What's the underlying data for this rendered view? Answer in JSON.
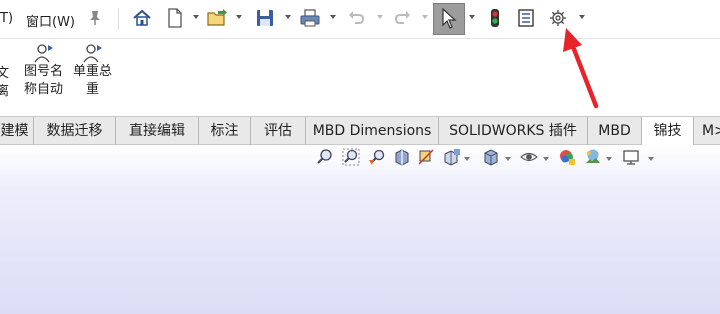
{
  "menubar": {
    "items": [
      "T)",
      "窗口(W)"
    ],
    "pin_icon": "pin-icon"
  },
  "toolbar": {
    "icons": [
      "home-icon",
      "new-file-icon",
      "open-folder-icon",
      "save-icon",
      "print-icon",
      "undo-icon",
      "redo-icon",
      "select-pointer-icon",
      "traffic-light-icon",
      "file-properties-icon",
      "gear-icon"
    ]
  },
  "ribbon": {
    "buttons": [
      {
        "line1": "文",
        "line2": "离"
      },
      {
        "line1": "图号名",
        "line2": "称自动"
      },
      {
        "line1": "单重总",
        "line2": "重"
      }
    ]
  },
  "tabs": [
    "建模",
    "数据迁移",
    "直接编辑",
    "标注",
    "评估",
    "MBD Dimensions",
    "SOLIDWORKS 插件",
    "MBD",
    "锦技",
    "M>"
  ],
  "active_tab": "锦技",
  "view_toolbar": {
    "icons": [
      "zoom-to-fit-icon",
      "zoom-area-icon",
      "previous-view-icon",
      "section-view-icon",
      "dynamic-annotation-icon",
      "view-orientation-icon",
      "display-style-icon",
      "hide-show-icon",
      "edit-appearance-icon",
      "apply-scene-icon",
      "view-settings-icon"
    ]
  },
  "colors": {
    "accent_arrow": "#e8232a",
    "select_button": "#9c9c9c",
    "viewport_bottom": "#dcdcf6"
  }
}
